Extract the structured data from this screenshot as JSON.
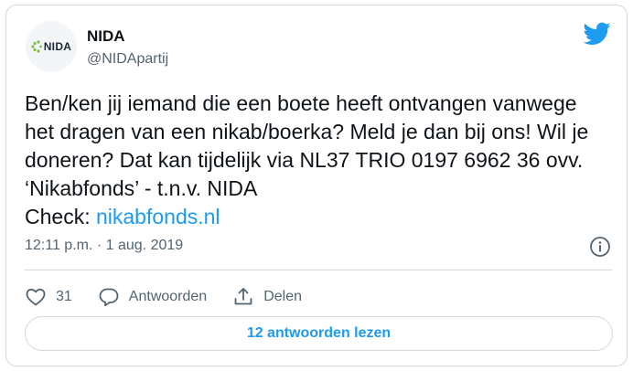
{
  "author": {
    "name": "NIDA",
    "handle": "@NIDApartij",
    "avatar_text": "NIDA"
  },
  "tweet": {
    "text": "Ben/ken jij iemand die een boete heeft ontvangen vanwege het dragen van een nikab/boerka? Meld je dan bij ons! Wil je doneren? Dat kan tijdelijk via NL37 TRIO 0197 6962 36 ovv. ‘Nikabfonds’ - t.n.v. NIDA",
    "check_label": "Check: ",
    "link_text": "nikabfonds.nl",
    "timestamp": "12:11 p.m. · 1 aug. 2019"
  },
  "actions": {
    "like_count": "31",
    "reply_label": "Antwoorden",
    "share_label": "Delen"
  },
  "replies_button": {
    "label": "12 antwoorden lezen"
  },
  "icons": {
    "brand": "twitter-bird-icon",
    "info": "info-icon",
    "like": "heart-icon",
    "reply": "speech-bubble-icon",
    "share": "share-upload-icon"
  },
  "colors": {
    "accent": "#1d9bf0",
    "text": "#0f1419",
    "secondary": "#536471",
    "border": "#cfd9de",
    "logo_green": "#7dc242"
  }
}
